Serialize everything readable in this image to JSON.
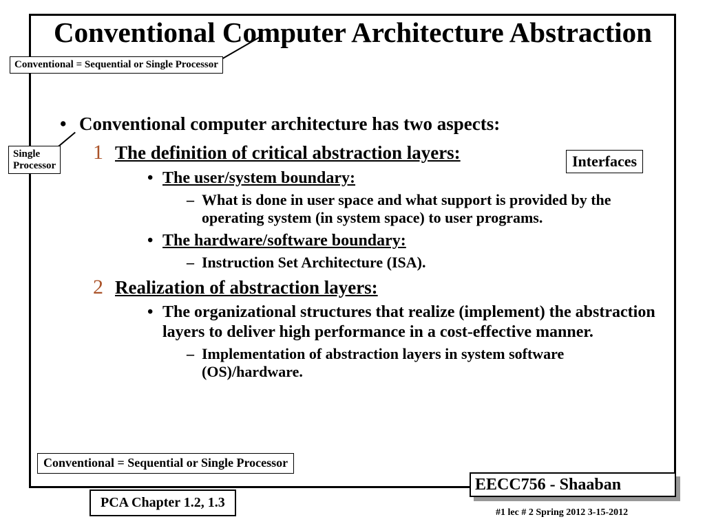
{
  "title": "Conventional Computer Architecture Abstraction",
  "bullets": {
    "main": "Conventional computer architecture has two aspects:",
    "item1": {
      "num": "1",
      "heading": "The definition of critical abstraction layers:",
      "sub1": {
        "head": "The user/system boundary:",
        "dash": "What is done in user space and what support is provided by the operating system (in system space) to user programs."
      },
      "sub2": {
        "head": "The hardware/software boundary:",
        "dash": "Instruction Set Architecture (ISA)."
      }
    },
    "item2": {
      "num": "2",
      "heading": "Realization of abstraction layers:",
      "sub1": {
        "text": "The organizational structures that realize (implement) the abstraction layers to deliver high performance in a cost-effective manner."
      },
      "dash": "Implementation of abstraction layers in system software (OS)/hardware."
    }
  },
  "callouts": {
    "top": "Conventional = Sequential or Single Processor",
    "single": "Single\nProcessor",
    "interfaces": "Interfaces",
    "bottom": "Conventional = Sequential or Single Processor",
    "pca": "PCA Chapter 1.2, 1.3",
    "course": "EECC756 - Shaaban"
  },
  "footer": "#1   lec # 2    Spring 2012   3-15-2012"
}
